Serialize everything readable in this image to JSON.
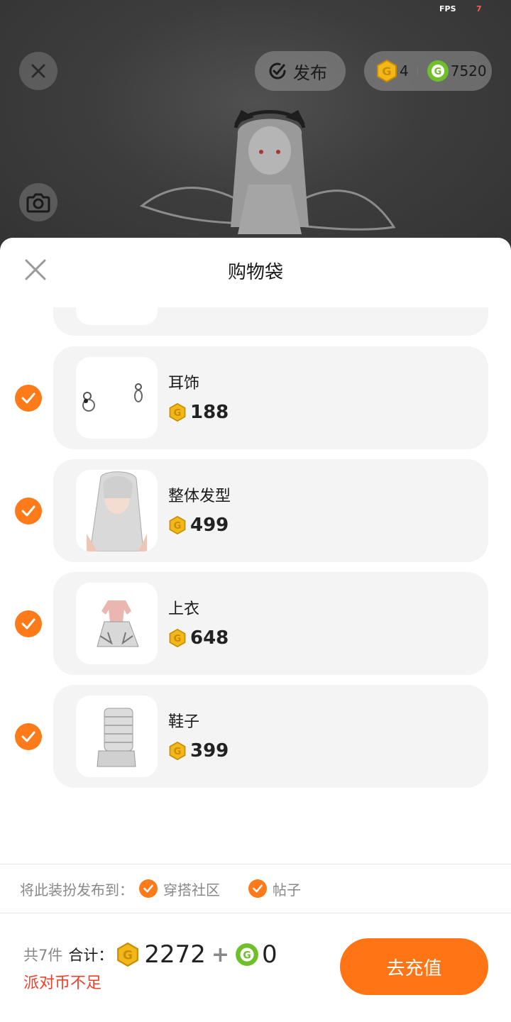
{
  "status": {
    "fps_label": "FPS",
    "fps_value": "7"
  },
  "top": {
    "publish_label": "发布",
    "gold_balance": "4",
    "green_balance": "7520"
  },
  "sheet": {
    "title": "购物袋",
    "items": [
      {
        "name": "耳饰",
        "price": "188",
        "thumb": "earrings"
      },
      {
        "name": "整体发型",
        "price": "499",
        "thumb": "hair"
      },
      {
        "name": "上衣",
        "price": "648",
        "thumb": "top"
      },
      {
        "name": "鞋子",
        "price": "399",
        "thumb": "shoes"
      }
    ],
    "publish_to": {
      "label": "将此装扮发布到：",
      "option1": "穿搭社区",
      "option2": "帖子"
    },
    "footer": {
      "count": "共7件",
      "total_label": "合计：",
      "gold_total": "2272",
      "plus": "+",
      "green_total": "0",
      "warning": "派对币不足",
      "recharge_button": "去充值"
    }
  },
  "colors": {
    "accent": "#ff7414",
    "gold_coin": "#f2b718",
    "green_coin": "#6fbf2a",
    "warning": "#f0402a"
  }
}
